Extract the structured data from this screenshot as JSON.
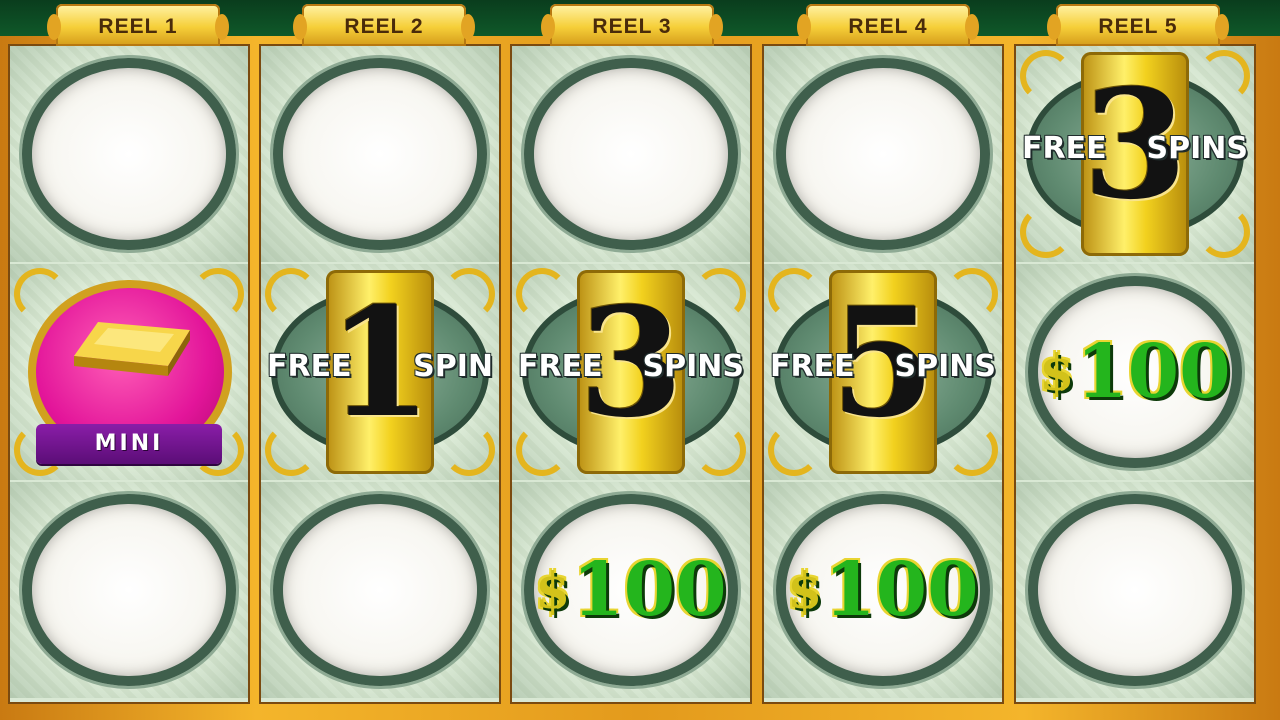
{
  "reels": [
    {
      "label": "REEL 1",
      "cells": [
        {
          "type": "blank"
        },
        {
          "type": "jackpot",
          "ribbon": "MINI"
        },
        {
          "type": "blank"
        }
      ]
    },
    {
      "label": "REEL 2",
      "cells": [
        {
          "type": "blank"
        },
        {
          "type": "free_spins",
          "left": "FREE",
          "number": "1",
          "right": "SPIN"
        },
        {
          "type": "blank"
        }
      ]
    },
    {
      "label": "REEL 3",
      "cells": [
        {
          "type": "blank"
        },
        {
          "type": "free_spins",
          "left": "FREE",
          "number": "3",
          "right": "SPINS"
        },
        {
          "type": "credit",
          "currency": "$",
          "amount": "100"
        }
      ]
    },
    {
      "label": "REEL 4",
      "cells": [
        {
          "type": "blank"
        },
        {
          "type": "free_spins",
          "left": "FREE",
          "number": "5",
          "right": "SPINS"
        },
        {
          "type": "credit",
          "currency": "$",
          "amount": "100"
        }
      ]
    },
    {
      "label": "REEL 5",
      "cells": [
        {
          "type": "free_spins",
          "left": "FREE",
          "number": "3",
          "right": "SPINS"
        },
        {
          "type": "credit",
          "currency": "$",
          "amount": "100"
        },
        {
          "type": "blank"
        }
      ]
    }
  ],
  "colors": {
    "frame_gold": "#f4b52b",
    "mini_pink": "#e3159a",
    "ribbon_purple": "#6a1288",
    "money_green": "#24b51d"
  }
}
